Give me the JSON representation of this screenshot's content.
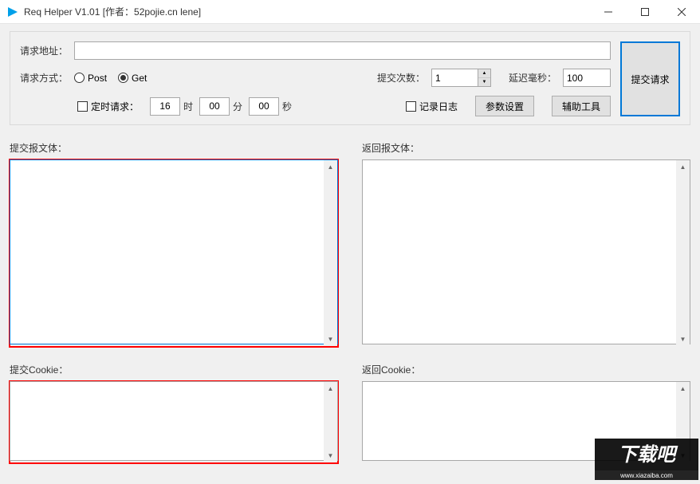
{
  "titlebar": {
    "title": "Req Helper V1.01    [作者：52pojie.cn lene]"
  },
  "top": {
    "url_label": "请求地址：",
    "url_value": "",
    "method_label": "请求方式：",
    "post_label": "Post",
    "get_label": "Get",
    "timer_label": "定时请求：",
    "hour_value": "16",
    "hour_unit": "时",
    "min_value": "00",
    "min_unit": "分",
    "sec_value": "00",
    "sec_unit": "秒",
    "count_label": "提交次数：",
    "count_value": "1",
    "delay_label": "延迟毫秒：",
    "delay_value": "100",
    "log_label": "记录日志",
    "params_btn": "参数设置",
    "tools_btn": "辅助工具",
    "submit_btn": "提交请求"
  },
  "sections": {
    "req_body_label": "提交报文体：",
    "resp_body_label": "返回报文体：",
    "req_cookie_label": "提交Cookie：",
    "resp_cookie_label": "返回Cookie："
  },
  "watermark": {
    "text_main": "下载吧",
    "text_sub": "www.xiazaiba.com"
  }
}
